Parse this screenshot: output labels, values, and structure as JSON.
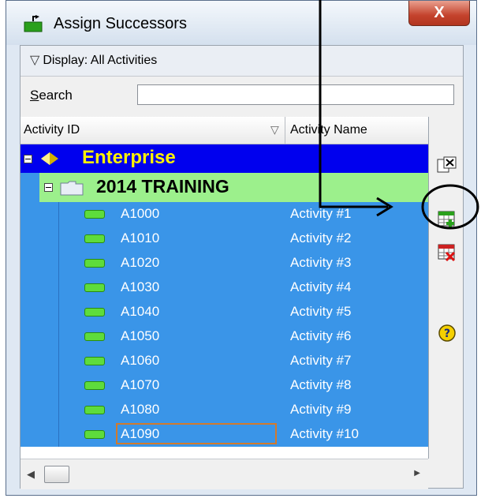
{
  "window": {
    "title": "Assign Successors",
    "close_label": "X"
  },
  "display_bar": {
    "label": "Display: All Activities"
  },
  "search": {
    "label_first": "S",
    "label_rest": "earch",
    "value": ""
  },
  "columns": {
    "id": "Activity ID",
    "name": "Activity Name"
  },
  "tree": {
    "enterprise": "Enterprise",
    "project": "2014 TRAINING",
    "activities": [
      {
        "id": "A1000",
        "name": "Activity #1"
      },
      {
        "id": "A1010",
        "name": "Activity #2"
      },
      {
        "id": "A1020",
        "name": "Activity #3"
      },
      {
        "id": "A1030",
        "name": "Activity #4"
      },
      {
        "id": "A1040",
        "name": "Activity #5"
      },
      {
        "id": "A1050",
        "name": "Activity #6"
      },
      {
        "id": "A1060",
        "name": "Activity #7"
      },
      {
        "id": "A1070",
        "name": "Activity #8"
      },
      {
        "id": "A1080",
        "name": "Activity #9"
      },
      {
        "id": "A1090",
        "name": "Activity #10"
      }
    ],
    "selected_index": 9
  },
  "side_buttons": [
    "close-panel-icon",
    "assign-icon",
    "remove-icon",
    "help-icon"
  ],
  "colors": {
    "enterprise_row": "#0000ee",
    "enterprise_text": "#fff200",
    "project_row": "#9cf08c",
    "activity_row": "#3a95e8",
    "selection_border": "#d27a2c"
  }
}
